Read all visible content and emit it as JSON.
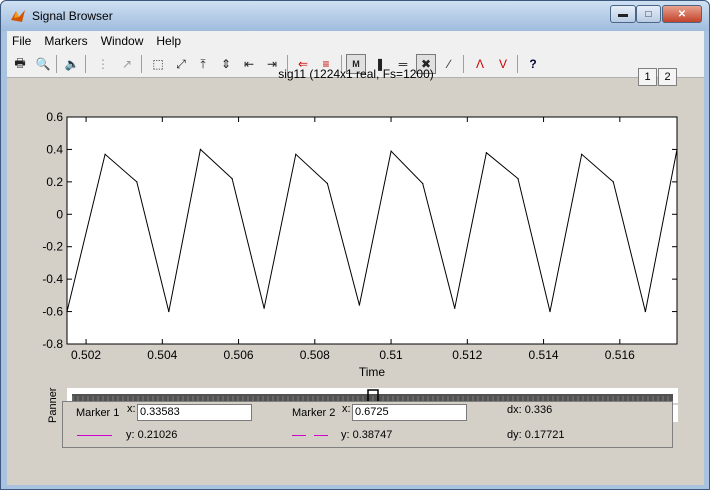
{
  "window": {
    "title": "Signal Browser"
  },
  "menu": [
    "File",
    "Markers",
    "Window",
    "Help"
  ],
  "toolbar_icons": [
    "print-icon",
    "print-preview-icon",
    "play-sound-icon",
    "select-signal-icon",
    "select-markers-icon",
    "zoom-box-icon",
    "zoom-full-icon",
    "zoom-y-icon",
    "zoom-in-y-icon",
    "zoom-in-x-icon",
    "zoom-out-x-icon",
    "channel-display-icon",
    "array-signal-icon",
    "markers-toggle-icon",
    "vertical-markers-icon",
    "horizontal-markers-icon",
    "track-markers-icon",
    "slope-markers-icon",
    "peaks-icon",
    "valleys-icon",
    "help-icon"
  ],
  "plot": {
    "title": "sig11 (1224x1 real, Fs=1200)",
    "xlabel": "Time",
    "page_buttons": [
      "1",
      "2"
    ]
  },
  "chart_data": {
    "type": "line",
    "title": "sig11 (1224x1 real, Fs=1200)",
    "xlabel": "Time",
    "ylabel": "",
    "xlim": [
      0.5015,
      0.5175
    ],
    "ylim": [
      -0.8,
      0.6
    ],
    "xticks": [
      "0.502",
      "0.504",
      "0.506",
      "0.508",
      "0.51",
      "0.512",
      "0.514",
      "0.516"
    ],
    "yticks": [
      "0.6",
      "0.4",
      "0.2",
      "0",
      "-0.2",
      "-0.4",
      "-0.6",
      "-0.8"
    ],
    "grid": false,
    "series": [
      {
        "color": "#000000",
        "points": [
          [
            0.5015,
            -0.6
          ],
          [
            0.5025,
            0.37
          ],
          [
            0.50333,
            0.2
          ],
          [
            0.50417,
            -0.6
          ],
          [
            0.505,
            0.4
          ],
          [
            0.50583,
            0.22
          ],
          [
            0.50667,
            -0.58
          ],
          [
            0.5075,
            0.37
          ],
          [
            0.50833,
            0.19
          ],
          [
            0.50917,
            -0.56
          ],
          [
            0.51,
            0.39
          ],
          [
            0.51083,
            0.19
          ],
          [
            0.51167,
            -0.58
          ],
          [
            0.5125,
            0.38
          ],
          [
            0.51333,
            0.22
          ],
          [
            0.51417,
            -0.6
          ],
          [
            0.515,
            0.37
          ],
          [
            0.51583,
            0.2
          ],
          [
            0.51667,
            -0.6
          ],
          [
            0.5175,
            0.4
          ]
        ]
      }
    ]
  },
  "panner": {
    "label": "Panner"
  },
  "markers": {
    "marker1": {
      "label": "Marker 1",
      "x_label": "x:",
      "x_value": "0.33583",
      "y_text": "y: 0.21026",
      "line_color": "#cc00cc"
    },
    "marker2": {
      "label": "Marker 2",
      "x_label": "x:",
      "x_value": "0.6725",
      "y_text": "y: 0.38747",
      "line_color": "#cc00cc"
    },
    "dx_text": "dx: 0.336",
    "dy_text": "dy: 0.17721"
  }
}
